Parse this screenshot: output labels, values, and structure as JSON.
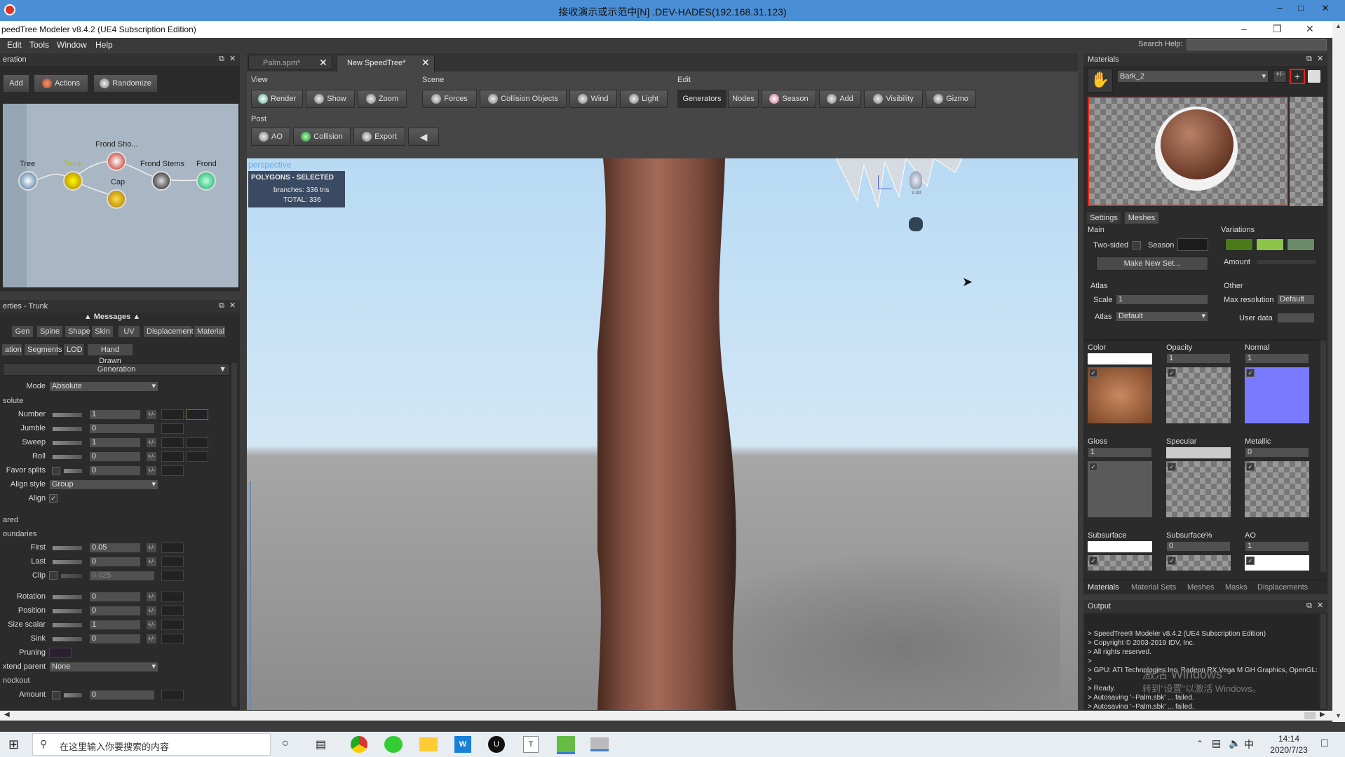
{
  "rdp": {
    "title": "接收演示或示范中[N] .DEV-HADES(192.168.31.123)"
  },
  "app": {
    "title": "peedTree Modeler v8.4.2 (UE4 Subscription Edition)"
  },
  "menu": {
    "items": [
      "Edit",
      "Tools",
      "Window",
      "Help"
    ],
    "search_label": "Search Help:"
  },
  "generation_panel": {
    "title": "eration",
    "buttons": {
      "add": "Add",
      "actions": "Actions",
      "randomize": "Randomize"
    },
    "nodes": {
      "tree": "Tree",
      "trunk": "Trunk",
      "frond_shoot": "Frond Sho...",
      "cap": "Cap",
      "frond_stems": "Frond Stems",
      "frond": "Frond"
    }
  },
  "properties_panel": {
    "title": "erties - Trunk",
    "messages": "Messages",
    "tabs_row1": [
      "Gen",
      "Spine",
      "Shape",
      "Skin",
      "UV",
      "Displacement",
      "Material"
    ],
    "tabs_row2": [
      "ation",
      "Segments",
      "LOD",
      "Hand Drawn"
    ],
    "section": "Generation",
    "mode_label": "Mode",
    "mode_value": "Absolute",
    "absolute_group": "solute",
    "rows": [
      {
        "label": "Number",
        "value": "1"
      },
      {
        "label": "Jumble",
        "value": "0"
      },
      {
        "label": "Sweep",
        "value": "1"
      },
      {
        "label": "Roll",
        "value": "0"
      },
      {
        "label": "Favor splits",
        "value": "0"
      }
    ],
    "align_style_label": "Align style",
    "align_style_value": "Group",
    "align_label": "Align",
    "shared_group": "ared",
    "boundaries_group": "oundaries",
    "boundary_rows": [
      {
        "label": "First",
        "value": "0.05"
      },
      {
        "label": "Last",
        "value": "0"
      },
      {
        "label": "Clip",
        "value": "0.025"
      }
    ],
    "transform_rows": [
      {
        "label": "Rotation",
        "value": "0"
      },
      {
        "label": "Position",
        "value": "0"
      },
      {
        "label": "Size scalar",
        "value": "1"
      },
      {
        "label": "Sink",
        "value": "0"
      }
    ],
    "pruning_label": "Pruning",
    "extend_parent_label": "xtend parent",
    "extend_parent_value": "None",
    "knockout_group": "nockout",
    "amount_label": "Amount",
    "amount_value": "0"
  },
  "tabs": [
    {
      "label": "Palm.spm*"
    },
    {
      "label": "New SpeedTree*"
    }
  ],
  "toolbar": {
    "view_label": "View",
    "scene_label": "Scene",
    "edit_label": "Edit",
    "post_label": "Post",
    "render": "Render",
    "show": "Show",
    "zoom": "Zoom",
    "forces": "Forces",
    "collision_objects": "Collision Objects",
    "wind": "Wind",
    "light": "Light",
    "generators": "Generators",
    "nodes": "Nodes",
    "season": "Season",
    "add": "Add",
    "visibility": "Visibility",
    "gizmo": "Gizmo",
    "ao": "AO",
    "collision": "Collision",
    "export": "Export"
  },
  "viewport": {
    "label": "perspective",
    "stats_title": "POLYGONS - SELECTED",
    "branches": "branches:  336 tris",
    "total": "TOTAL:  336",
    "scale_label": "2.00"
  },
  "materials_panel": {
    "title": "Materials",
    "material_name": "Bark_2",
    "tabs": [
      "Settings",
      "Meshes"
    ],
    "main": "Main",
    "two_sided": "Two-sided",
    "season": "Season",
    "make_new_set": "Make New Set...",
    "variations": "Variations",
    "amount": "Amount",
    "atlas_group": "Atlas",
    "scale_label": "Scale",
    "scale_value": "1",
    "atlas_label": "Atlas",
    "atlas_value": "Default",
    "other_group": "Other",
    "max_res_label": "Max resolution",
    "max_res_value": "Default",
    "user_data_label": "User data",
    "maps": [
      {
        "label": "Color",
        "value": ""
      },
      {
        "label": "Opacity",
        "value": "1"
      },
      {
        "label": "Normal",
        "value": "1"
      },
      {
        "label": "Gloss",
        "value": "1"
      },
      {
        "label": "Specular",
        "value": ""
      },
      {
        "label": "Metallic",
        "value": "0"
      },
      {
        "label": "Subsurface",
        "value": ""
      },
      {
        "label": "Subsurface%",
        "value": "0"
      },
      {
        "label": "AO",
        "value": "1"
      }
    ],
    "bottom_tabs": [
      "Materials",
      "Material Sets",
      "Meshes",
      "Masks",
      "Displacements"
    ],
    "variation_colors": [
      "#4c7a1a",
      "#8cc44a",
      "#6a8a6a"
    ]
  },
  "output_panel": {
    "title": "Output",
    "lines": [
      "> SpeedTree® Modeler v8.4.2 (UE4 Subscription Edition)",
      "> Copyright © 2003-2019 IDV, Inc.",
      "> All rights reserved.",
      ">",
      "> GPU: ATI Technologies Inc. Radeon RX Vega M GH Graphics, OpenGL:",
      ">",
      "> Ready.",
      "> Autosaving '~Palm.sbk' ... failed.",
      "> Autosaving '~Palm.sbk' ... failed."
    ],
    "watermark1": "激活 Windows",
    "watermark2": "转到\"设置\"以激活 Windows。"
  },
  "taskbar": {
    "search_placeholder": "在这里输入你要搜索的内容",
    "time": "14:14",
    "date": "2020/7/23",
    "ime": "中"
  }
}
